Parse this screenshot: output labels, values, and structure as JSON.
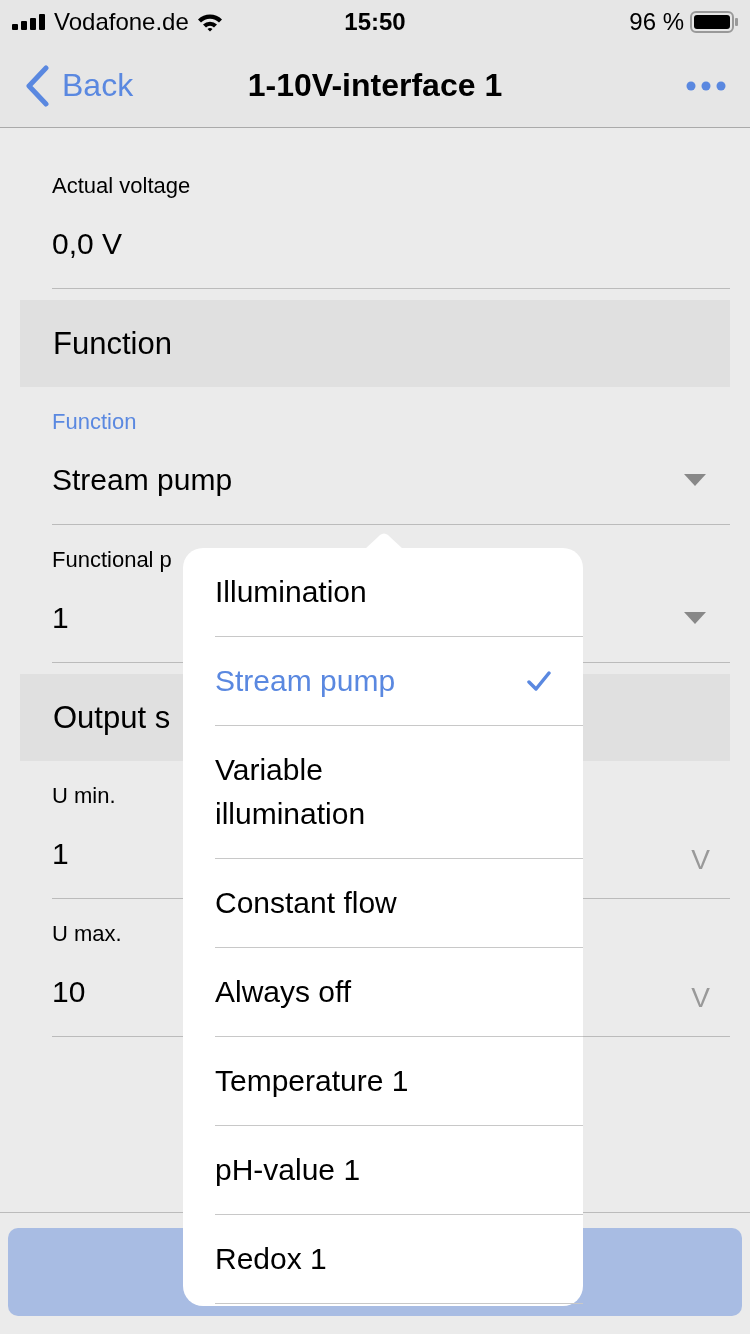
{
  "status_bar": {
    "carrier": "Vodafone.de",
    "time": "15:50",
    "battery": "96 %"
  },
  "nav": {
    "back": "Back",
    "title": "1-10V-interface 1"
  },
  "form": [
    {
      "kind": "readout",
      "label": "Actual voltage",
      "value": "0,0 V"
    },
    {
      "kind": "header",
      "text": "Function"
    },
    {
      "kind": "select",
      "label": "Function",
      "value": "Stream pump",
      "focused": true
    },
    {
      "kind": "select",
      "label": "Functional p",
      "value": "1",
      "focused": false
    },
    {
      "kind": "header",
      "text": "Output s"
    },
    {
      "kind": "input",
      "label": "U min.",
      "value": "1",
      "unit": "V"
    },
    {
      "kind": "input",
      "label": "U max.",
      "value": "10",
      "unit": "V"
    }
  ],
  "options": [
    {
      "label": "Illumination",
      "selected": false
    },
    {
      "label": "Stream pump",
      "selected": true
    },
    {
      "label": "Variable illumination",
      "selected": false
    },
    {
      "label": "Constant flow",
      "selected": false
    },
    {
      "label": "Always off",
      "selected": false
    },
    {
      "label": "Temperature 1",
      "selected": false
    },
    {
      "label": "pH-value 1",
      "selected": false
    },
    {
      "label": "Redox 1",
      "selected": false
    }
  ]
}
